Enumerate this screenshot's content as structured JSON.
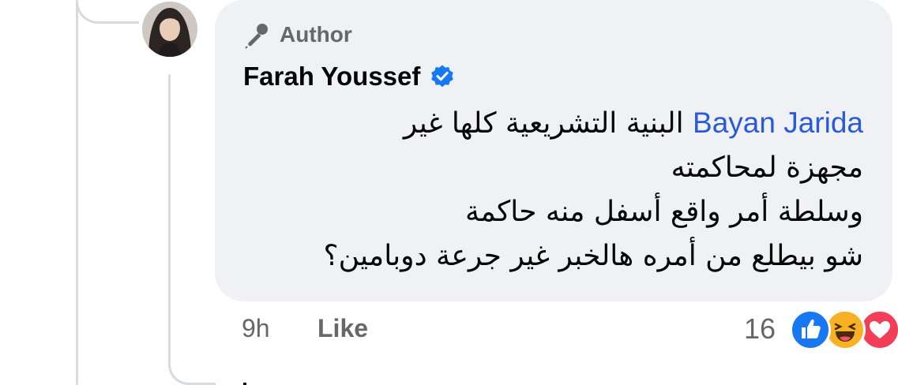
{
  "comment": {
    "badge_label": "Author",
    "badge_icon": "microphone-icon",
    "commenter_name": "Farah Youssef",
    "verified_icon": "verified-badge-icon",
    "mention": "Bayan Jarida",
    "text_line_1": "البنية التشريعية كلها غير",
    "text_line_2": "مجهزة لمحاكمته",
    "text_line_3": "وسلطة أمر واقع أسفل منه حاكمة",
    "text_line_4": "شو بيطلع من أمره هالخبر غير جرعة دوبامين؟"
  },
  "footer": {
    "timestamp": "9h",
    "like_label": "Like",
    "reaction_count": "16",
    "reactions": [
      "like-reaction-icon",
      "haha-reaction-icon",
      "love-reaction-icon"
    ]
  },
  "colors": {
    "bubble": "#eff1f4",
    "mention": "#2a5bd7",
    "meta_text": "#65676b",
    "verified": "#1877f2",
    "like": "#1877f2",
    "haha": "#f7b125",
    "love": "#f33e58"
  }
}
